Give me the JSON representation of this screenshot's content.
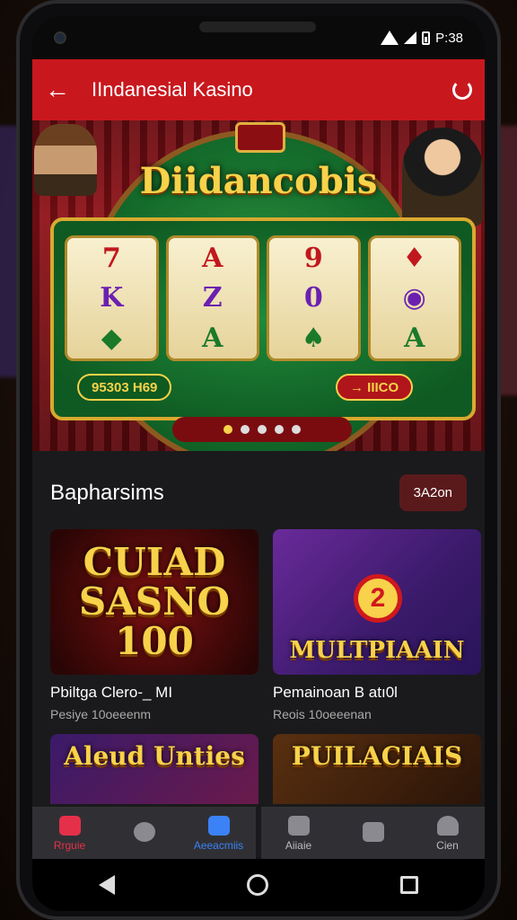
{
  "status": {
    "time": "P:38"
  },
  "appbar": {
    "title": "IIndanesial Kasino"
  },
  "banner": {
    "title": "Diidancobis",
    "reels": [
      [
        "7",
        "K",
        "◆"
      ],
      [
        "A",
        "Z",
        "A"
      ],
      [
        "9",
        "0",
        "♠"
      ],
      [
        "♦",
        "◉",
        "A"
      ]
    ],
    "pay_left": "95303 H69",
    "pay_right": "→ IIICO",
    "dots": 5,
    "active_dot": 0
  },
  "section": {
    "title": "Bapharsims",
    "button_label": "3A2on"
  },
  "cards": [
    {
      "image_text": "CUIAD SASNO 100",
      "title": "Pbiltga Clero-_ MI",
      "subtitle": "Pesiye 10oeeenm"
    },
    {
      "image_text": "MULTPIAAIN",
      "badge": "2",
      "title": "Pemainoan B atı0l",
      "subtitle": "Reois 10oeeenan"
    },
    {
      "image_text": "Aleud Unties"
    },
    {
      "image_text": "PUILACIAIS"
    }
  ],
  "tabs": [
    {
      "label": "Rrguie",
      "icon": "gift-icon",
      "style": "red"
    },
    {
      "label": "",
      "icon": "search-icon",
      "style": "grey"
    },
    {
      "label": "Aeeacmiis",
      "icon": "user-icon",
      "style": "blue"
    },
    {
      "label": "Aiiaie",
      "icon": "grid-icon",
      "style": "grey"
    },
    {
      "label": "",
      "icon": "lock-icon",
      "style": "grey"
    },
    {
      "label": "Cien",
      "icon": "profile-icon",
      "style": "grey"
    }
  ],
  "colors": {
    "primary": "#c8181e",
    "gold": "#f7d24a",
    "table_green": "#1f8a3a"
  }
}
